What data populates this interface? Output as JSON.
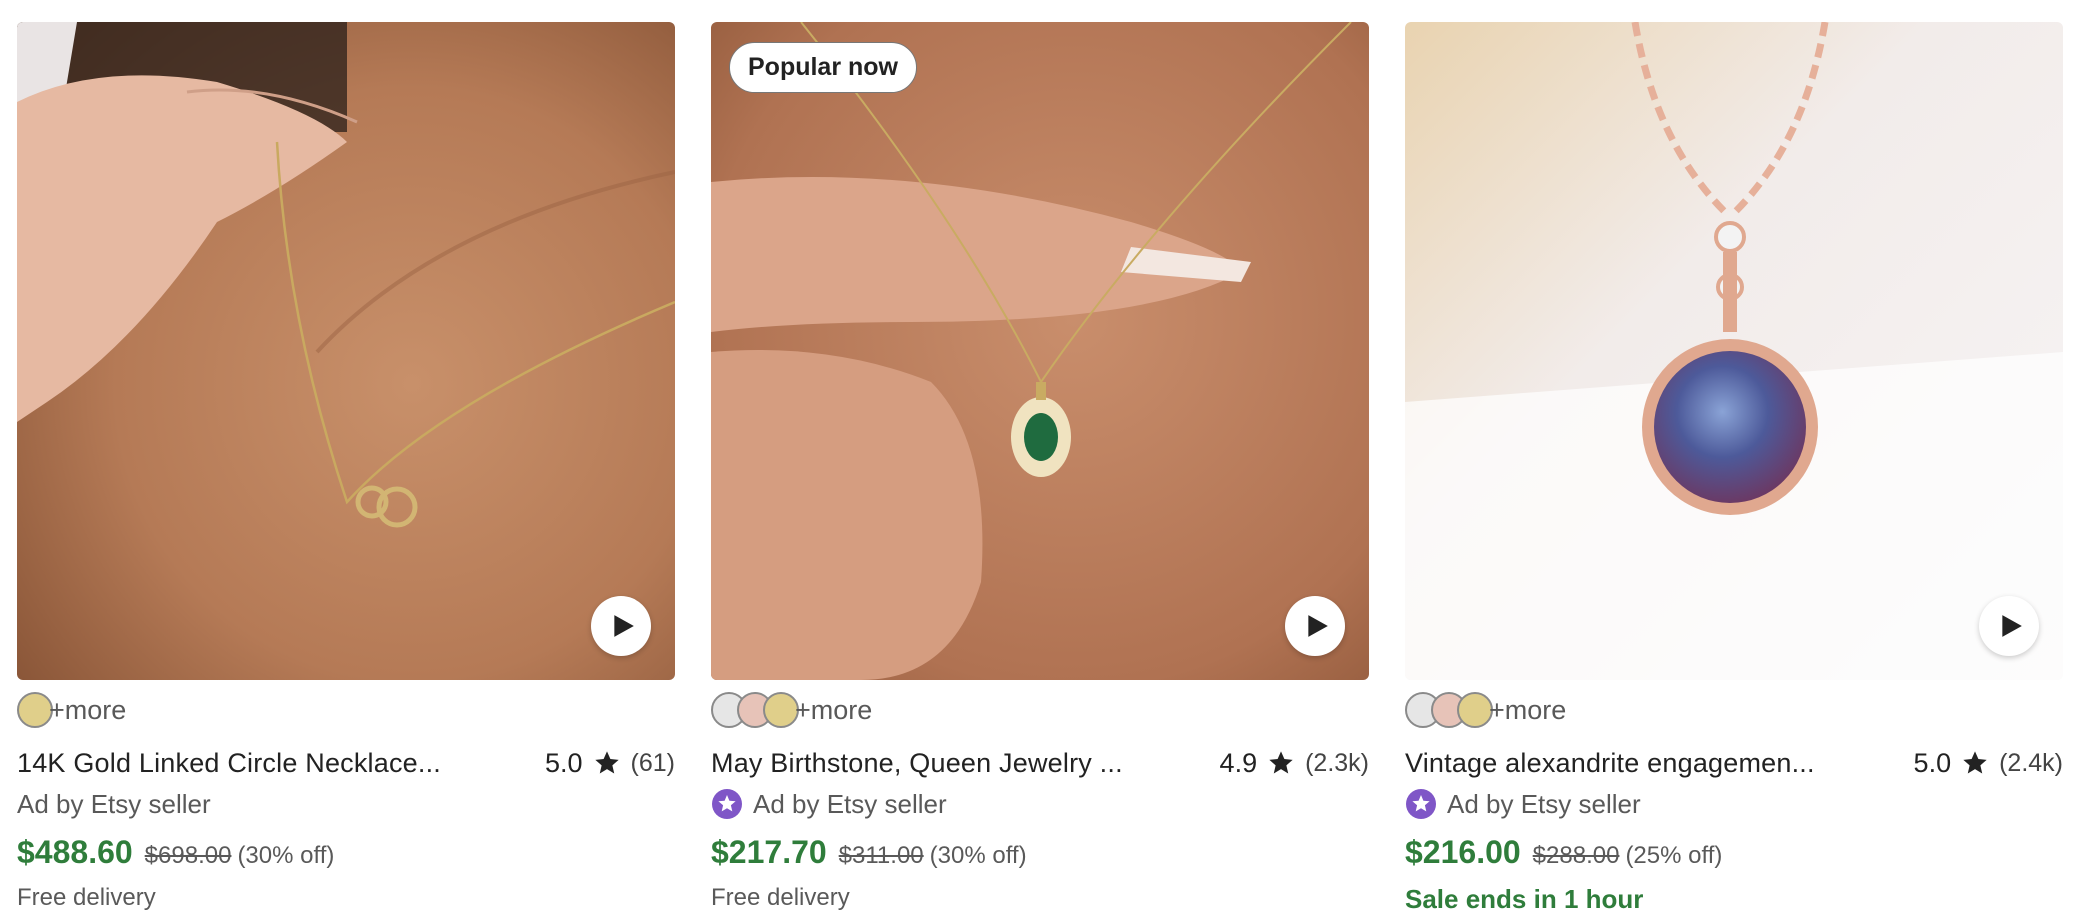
{
  "listings": [
    {
      "badge": "",
      "swatches": [
        "#e0cf8a"
      ],
      "more_label": "+more",
      "title": "14K Gold Linked Circle Necklace...",
      "rating": "5.0",
      "review_count": "(61)",
      "ad_label": "Ad by Etsy seller",
      "star_seller": false,
      "price": "$488.60",
      "original_price": "$698.00",
      "discount": "(30% off)",
      "footer": "Free delivery",
      "footer_is_sale": false
    },
    {
      "badge": "Popular now",
      "swatches": [
        "#e6e6e6",
        "#e7c3b8",
        "#e0cf8a"
      ],
      "more_label": "+more",
      "title": "May Birthstone, Queen Jewelry ...",
      "rating": "4.9",
      "review_count": "(2.3k)",
      "ad_label": "Ad by Etsy seller",
      "star_seller": true,
      "price": "$217.70",
      "original_price": "$311.00",
      "discount": "(30% off)",
      "footer": "Free delivery",
      "footer_is_sale": false
    },
    {
      "badge": "",
      "swatches": [
        "#e6e6e6",
        "#e7c3b8",
        "#e0cf8a"
      ],
      "more_label": "+more",
      "title": "Vintage alexandrite engagemen...",
      "rating": "5.0",
      "review_count": "(2.4k)",
      "ad_label": "Ad by Etsy seller",
      "star_seller": true,
      "price": "$216.00",
      "original_price": "$288.00",
      "discount": "(25% off)",
      "footer": "Sale ends in 1 hour",
      "footer_is_sale": true
    }
  ],
  "colors": {
    "price_green": "#2f7d3b",
    "star_seller_purple": "#7f56c7",
    "muted_text": "#595959"
  },
  "icons": {
    "play": "play-icon",
    "rating_star": "star-icon",
    "star_seller": "star-seller-icon"
  }
}
